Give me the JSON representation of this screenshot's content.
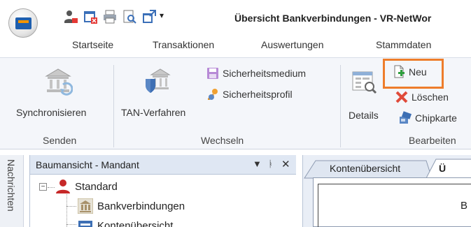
{
  "window": {
    "title": "Übersicht Bankverbindungen - VR-NetWor",
    "quick_access_overflow": "▾"
  },
  "ribbon_tabs": [
    "Startseite",
    "Transaktionen",
    "Auswertungen",
    "Stammdaten"
  ],
  "ribbon": {
    "groups": {
      "senden": "Senden",
      "wechseln": "Wechseln",
      "bearbeiten": "Bearbeiten"
    },
    "buttons": {
      "synchronisieren": "Synchronisieren",
      "tan_verfahren": "TAN-Verfahren",
      "sicherheitsmedium": "Sicherheitsmedium",
      "sicherheitsprofil": "Sicherheitsprofil",
      "details": "Details",
      "neu": "Neu",
      "loeschen": "Löschen",
      "chipkarte": "Chipkarte"
    }
  },
  "side_strip": {
    "label": "Nachrichten"
  },
  "tree": {
    "title": "Baumansicht - Mandant",
    "header_icons": {
      "dropdown": "▼",
      "pin": "ᚭ",
      "close": "✕"
    },
    "expander": "−",
    "nodes": {
      "root": "Standard",
      "bankverbindungen": "Bankverbindungen",
      "kontenuebersicht": "Kontenübersicht"
    }
  },
  "document": {
    "tabs": [
      "Kontenübersicht",
      "Ü"
    ],
    "content_letter": "B"
  },
  "colors": {
    "highlight": "#ee7d2b",
    "ribbon_bg": "#f4f6fa",
    "panel_header": "#dfe7f3",
    "brand_blue": "#1f5fae",
    "brand_orange": "#f29400"
  }
}
